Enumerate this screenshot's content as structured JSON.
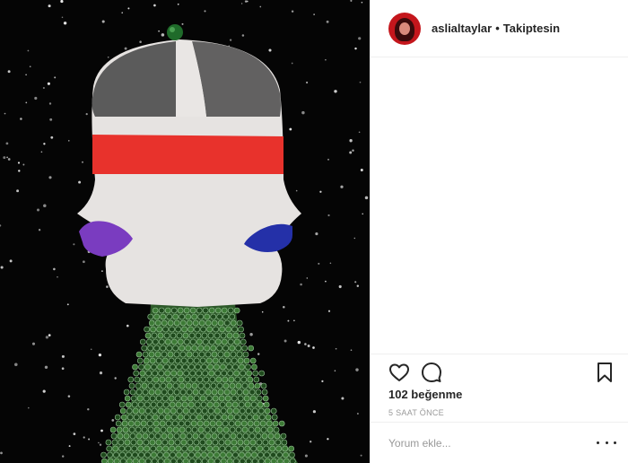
{
  "post": {
    "username": "aslialtaylar",
    "separator": "•",
    "follow_status": "Takiptesin",
    "likes_text": "102 beğenme",
    "timestamp": "5 SAAT ÖNCE",
    "comment_placeholder": "Yorum ekle..."
  },
  "icons": {
    "like": "heart-outline-icon",
    "comment": "speech-bubble-icon",
    "save": "bookmark-icon",
    "more": "three-dots-icon"
  },
  "colors": {
    "background": "#050505",
    "headband": "#e8322c",
    "lips_left": "#7a3cc0",
    "lips_right": "#2430a8",
    "sweater": "#2e5a2a",
    "hat_dark": "#5a5a5a",
    "avatar": "#c4161c"
  }
}
